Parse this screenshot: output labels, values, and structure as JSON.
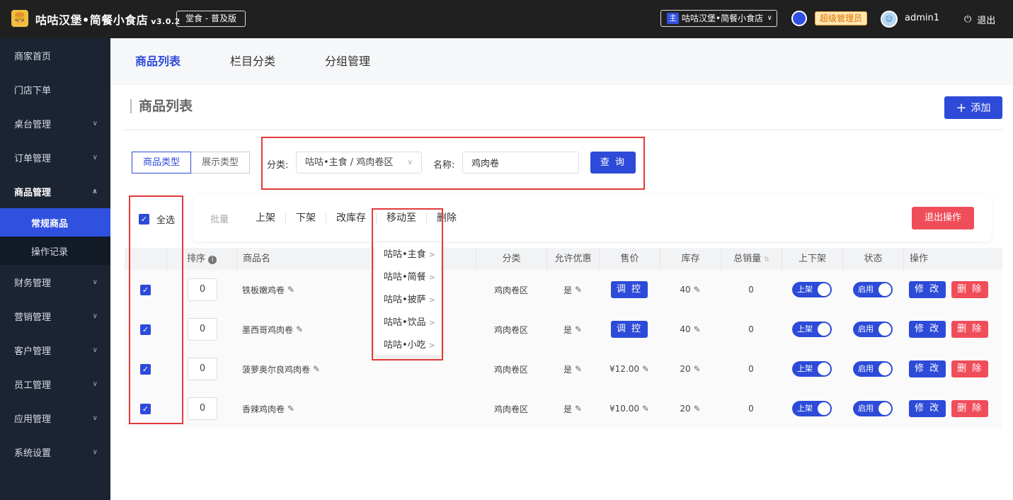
{
  "header": {
    "app_name": "咕咕汉堡•简餐小食店",
    "version": "v3.0.2",
    "edition": "堂食 - 普及版",
    "store_badge": "主",
    "store_name": "咕咕汉堡•简餐小食店",
    "role": "超级管理员",
    "username": "admin1",
    "logout": "退出"
  },
  "sidebar": {
    "items": [
      {
        "label": "商家首页"
      },
      {
        "label": "门店下单"
      },
      {
        "label": "桌台管理"
      },
      {
        "label": "订单管理"
      },
      {
        "label": "商品管理"
      },
      {
        "label": "财务管理"
      },
      {
        "label": "营销管理"
      },
      {
        "label": "客户管理"
      },
      {
        "label": "员工管理"
      },
      {
        "label": "应用管理"
      },
      {
        "label": "系统设置"
      }
    ],
    "sub_items": [
      {
        "label": "常规商品"
      },
      {
        "label": "操作记录"
      }
    ]
  },
  "tabs": [
    {
      "label": "商品列表"
    },
    {
      "label": "栏目分类"
    },
    {
      "label": "分组管理"
    }
  ],
  "page": {
    "title": "商品列表",
    "add_label": "添加"
  },
  "filter": {
    "type_tab_1": "商品类型",
    "type_tab_2": "展示类型",
    "category_label": "分类:",
    "category_value": "咕咕•主食 / 鸡肉卷区",
    "name_label": "名称:",
    "name_value": "鸡肉卷",
    "query_label": "查 询"
  },
  "batch": {
    "select_all": "全选",
    "label": "批量",
    "ops": [
      "上架",
      "下架",
      "改库存",
      "移动至",
      "删除"
    ],
    "exit": "退出操作"
  },
  "move_menu": [
    "咕咕•主食",
    "咕咕•简餐",
    "咕咕•披萨",
    "咕咕•饮品",
    "咕咕•小吃"
  ],
  "table": {
    "headers": [
      "排序",
      "商品名",
      "分类",
      "允许优惠",
      "售价",
      "库存",
      "总销量",
      "上下架",
      "状态",
      "操作"
    ],
    "rows": [
      {
        "sort": "0",
        "name": "铁板嫩鸡卷",
        "category": "鸡肉卷区",
        "discount": "是",
        "price": "调 控",
        "stock": "40",
        "sales": "0",
        "shelf": "上架",
        "state": "启用",
        "edit": "修 改",
        "del": "删 除"
      },
      {
        "sort": "0",
        "name": "墨西哥鸡肉卷",
        "category": "鸡肉卷区",
        "discount": "是",
        "price": "调 控",
        "stock": "40",
        "sales": "0",
        "shelf": "上架",
        "state": "启用",
        "edit": "修 改",
        "del": "删 除"
      },
      {
        "sort": "0",
        "name": "菠萝奥尔良鸡肉卷",
        "category": "鸡肉卷区",
        "discount": "是",
        "price": "¥12.00",
        "stock": "20",
        "sales": "0",
        "shelf": "上架",
        "state": "启用",
        "edit": "修 改",
        "del": "删 除"
      },
      {
        "sort": "0",
        "name": "香辣鸡肉卷",
        "category": "鸡肉卷区",
        "discount": "是",
        "price": "¥10.00",
        "stock": "20",
        "sales": "0",
        "shelf": "上架",
        "state": "启用",
        "edit": "修 改",
        "del": "删 除"
      }
    ]
  },
  "colors": {
    "accent": "#2d4bd8",
    "danger": "#f04d5a",
    "sidebar": "#1c2433",
    "topbar": "#202020"
  }
}
